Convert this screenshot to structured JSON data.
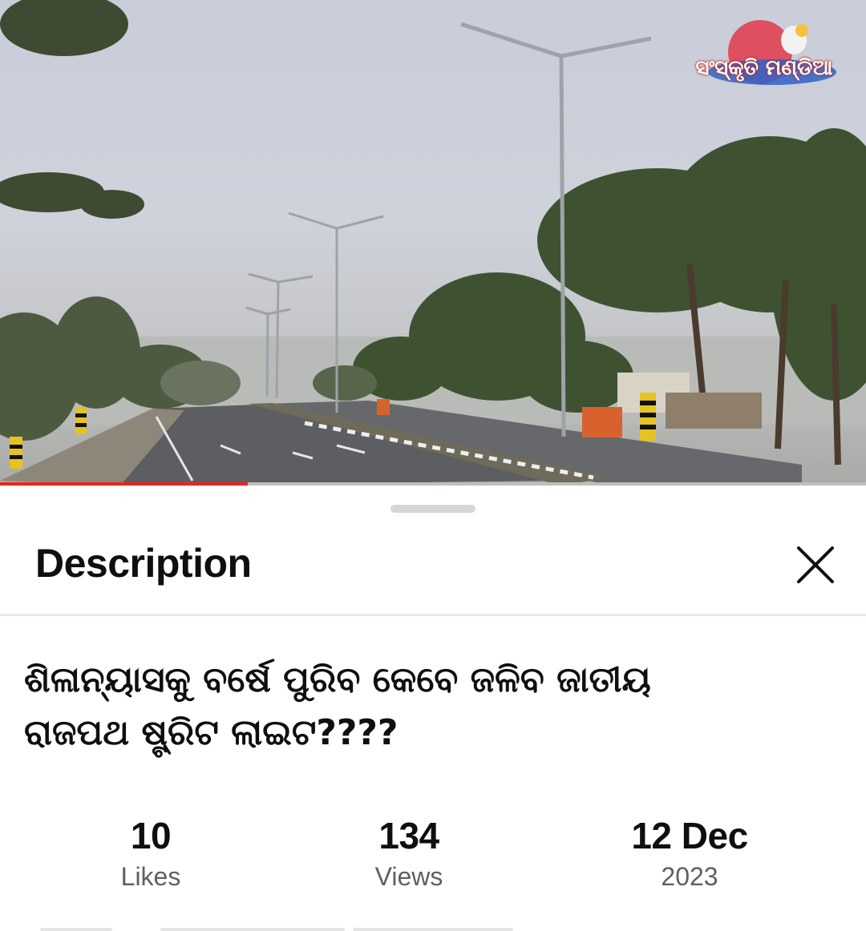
{
  "video": {
    "channel_logo_text": "ସଂସ୍କୃତି ମଣ୍ଡିଆ",
    "progress_percent": 28.6
  },
  "sheet": {
    "title": "Description",
    "headline_line1": "ଶିଳାନ୍ୟାସକୁ ବର୍ଷେ ପୁରିବ କେବେ ଜଳିବ ଜାତୀୟ",
    "headline_line2": "ରାଜପଥ ଷ୍ଟ୍ରିଟ ଲାଇଟ????",
    "stats": [
      {
        "value": "10",
        "label": "Likes"
      },
      {
        "value": "134",
        "label": "Views"
      },
      {
        "value": "12 Dec",
        "label": "2023"
      }
    ]
  },
  "colors": {
    "accent": "#e8261f",
    "text_primary": "#0f0f0f",
    "text_secondary": "#606060"
  },
  "icons": {
    "close": "close-icon",
    "logo": "channel-logo-icon"
  }
}
